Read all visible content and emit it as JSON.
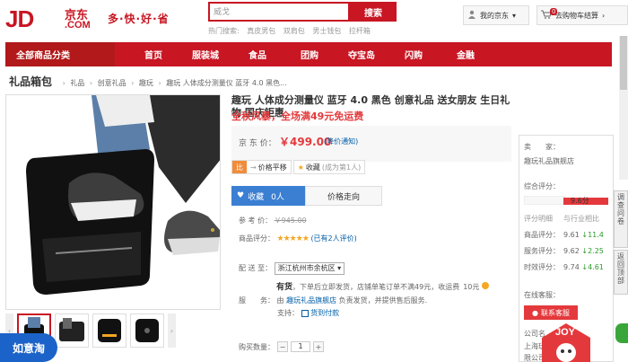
{
  "header": {
    "logo_jd": "JD",
    "logo_cn": "京东",
    "logo_com": ".COM",
    "slogan": "多·快·好·省",
    "search_value": "威戈",
    "search_button": "搜索",
    "hot_label": "热门搜索:",
    "hot_words": [
      "真皮男包",
      "双肩包",
      "男士钱包",
      "拉杆箱"
    ],
    "my_jd": "我的京东",
    "cart_label": "去购物车结算",
    "cart_count": "0",
    "brand_color": "#c81623"
  },
  "nav": {
    "category": "全部商品分类",
    "items": [
      "首页",
      "服装城",
      "食品",
      "团购",
      "夺宝岛",
      "闪购",
      "金融"
    ]
  },
  "breadcrumb": {
    "title": "礼品箱包",
    "items": [
      "礼品",
      "创意礼品",
      "趣玩",
      "趣玩 人体成分测量仪 蓝牙 4.0 黑色..."
    ]
  },
  "product": {
    "title": "趣玩 人体成分测量仪 蓝牙 4.0 黑色 创意礼品 送女朋友 生日礼物 国庆钜惠",
    "promo": "全秋风暴，全场满49元免运费",
    "price_label": "京 东 价：",
    "price": "￥499.00",
    "price_notify": "(降价通知)",
    "price_compare": "价格平移",
    "favorite": "收藏",
    "favorite_count": "(成为第1人)",
    "follow": "收藏",
    "follow_count": "0人",
    "price_trend": "价格走向",
    "ref_label": "参 考 价：",
    "ref_price": "￥945.00",
    "rating_label": "商品评分：",
    "rating_stars": "★★★★★",
    "rating_text": "(已有2人评价)",
    "delivery_label": "配 送 至：",
    "region": "浙江杭州市余杭区",
    "stock": "有货",
    "stock_note": "，下单后立即发货，店铺单笔订单不满49元，收运费",
    "shipping_fee": "10元",
    "service_label": "服　　务：",
    "service_by": "由",
    "shop_name": "趣玩礼品旗舰店",
    "service_note": "负责发货，并提供售后服务.",
    "support_label": "支持：",
    "support_item": "货到付款",
    "qty_label": "购买数量：",
    "qty": "1"
  },
  "thumbnails": [
    "thumb-1",
    "thumb-2",
    "thumb-3",
    "thumb-4"
  ],
  "shop": {
    "seller_label": "卖　　家：",
    "seller_name": "趣玩礼品旗舰店",
    "overall_label": "综合评分：",
    "overall_score": "9.6分",
    "score_header": "评分明细",
    "compare_header": "与行业相比",
    "rows": [
      {
        "label": "商品评分：",
        "score": "9.61",
        "delta": "11.4"
      },
      {
        "label": "服务评分：",
        "score": "9.62",
        "delta": "2.25"
      },
      {
        "label": "时效评分：",
        "score": "9.74",
        "delta": "4.61"
      }
    ],
    "online_label": "在线客服：",
    "contact": "联系客服",
    "company_label": "公司名",
    "company_line1": "上海玩趣",
    "company_line2": "限公司"
  },
  "side_tools": [
    "调查问卷",
    "返回顶部"
  ],
  "bottom": {
    "ruyi": "如意淘",
    "joy": "JOY"
  }
}
